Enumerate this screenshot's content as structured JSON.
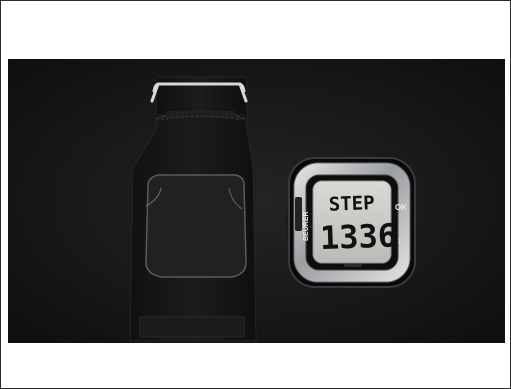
{
  "photo": {
    "display_line1": "STEP",
    "display_line2": "1336",
    "button_ok": "OK",
    "button_arrows": "↕",
    "side_label": "BEURER",
    "strap_color": "#141414",
    "frame_color": "#bfc2c5",
    "screen_color": "#c9cbc7"
  }
}
